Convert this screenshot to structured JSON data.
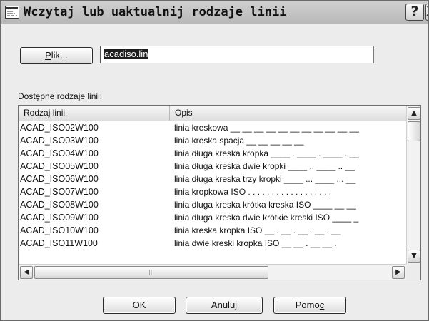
{
  "window": {
    "title": "Wczytaj lub uaktualnij rodzaje linii",
    "help_glyph": "?",
    "close_glyph": "X"
  },
  "file": {
    "button_label": "Plik...",
    "button_mnemonic": "P",
    "value": "acadiso.lin"
  },
  "list": {
    "caption": "Dostępne rodzaje linii:",
    "columns": [
      "Rodzaj linii",
      "Opis"
    ],
    "rows": [
      {
        "name": "ACAD_ISO02W100",
        "desc": "linia kreskowa __ __ __ __ __ __ __ __ __ __ __"
      },
      {
        "name": "ACAD_ISO03W100",
        "desc": "linia kreska spacja __     __     __     __     __"
      },
      {
        "name": "ACAD_ISO04W100",
        "desc": "linia długa kreska kropka ____ . ____ . ____ . __"
      },
      {
        "name": "ACAD_ISO05W100",
        "desc": "linia długa kreska dwie kropki ____ .. ____ .. __"
      },
      {
        "name": "ACAD_ISO06W100",
        "desc": "linia długa kreska trzy kropki ____ ... ____ ... __"
      },
      {
        "name": "ACAD_ISO07W100",
        "desc": "linia kropkowa ISO . . . . . . . . . . . . . . . . . ."
      },
      {
        "name": "ACAD_ISO08W100",
        "desc": "linia długa kreska krótka kreska ISO ____ __ __"
      },
      {
        "name": "ACAD_ISO09W100",
        "desc": "linia długa kreska dwie krótkie kreski ISO ____ _"
      },
      {
        "name": "ACAD_ISO10W100",
        "desc": "linia kreska kropka ISO __ . __ . __ . __ . __"
      },
      {
        "name": "ACAD_ISO11W100",
        "desc": "linia dwie kreski kropka ISO __ __ . __ __ ."
      }
    ]
  },
  "buttons": {
    "ok": "OK",
    "cancel": "Anuluj",
    "help": "Pomoc",
    "help_mnemonic": "c"
  },
  "icons": {
    "title": "window-app-icon",
    "up": "scroll-up-arrow-icon",
    "down": "scroll-down-arrow-icon",
    "left": "scroll-left-arrow-icon",
    "right": "scroll-right-arrow-icon"
  }
}
